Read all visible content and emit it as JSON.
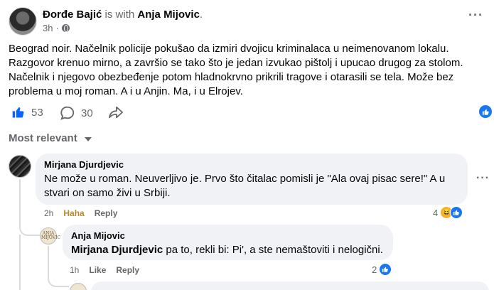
{
  "post": {
    "author": "Đorđe Bajić",
    "with_text": "is with",
    "tagged": "Anja Mijovic",
    "punct": ".",
    "time": "3h",
    "dot": "·",
    "text": "Beograd noir. Načelnik policije pokušao da izmiri dvojicu kriminalaca u neimenovanom lokalu. Razgovor krenuo mirno, a završio se tako što je jedan izvukao pištolj i upucao drugog za stolom. Načelnik i njegovo obezbeđenje potom hladnokrvno prikrili tragove i otarasili se tela. Može bez problema u moj roman. A i u Anjin. Ma, i u Elrojev.",
    "like_count": "53",
    "comment_count": "30"
  },
  "sort": {
    "label": "Most relevant"
  },
  "comments": [
    {
      "author": "Mirjana Djurdjevic",
      "text": "Ne može u roman. Neuverljivo je. Prvo što čitalac pomisli je \"Ala ovaj pisac sere!\" A u stvari on samo živi u Srbiji.",
      "time": "2h",
      "reaction_label": "Haha",
      "reply_label": "Reply",
      "reaction_count": "4"
    },
    {
      "author": "Anja Mijovic",
      "mention": "Mirjana Djurdjevic",
      "text": " pa to, rekli bi: Pi', a ste nemaštoviti i nelogični.",
      "time": "1h",
      "like_label": "Like",
      "reply_label": "Reply",
      "reaction_count": "2",
      "avatar_text": "ANJA MIJOVIC"
    }
  ],
  "icons": {
    "more": "more-horizontal-icon",
    "globe": "globe-icon",
    "like": "thumbs-up-icon",
    "comment": "comment-bubble-icon",
    "share": "share-arrow-icon",
    "caret": "chevron-down-icon"
  },
  "colors": {
    "accent": "#1877f2",
    "haha": "#f7b125",
    "muted": "#65676b",
    "bubble": "#f0f2f5"
  }
}
